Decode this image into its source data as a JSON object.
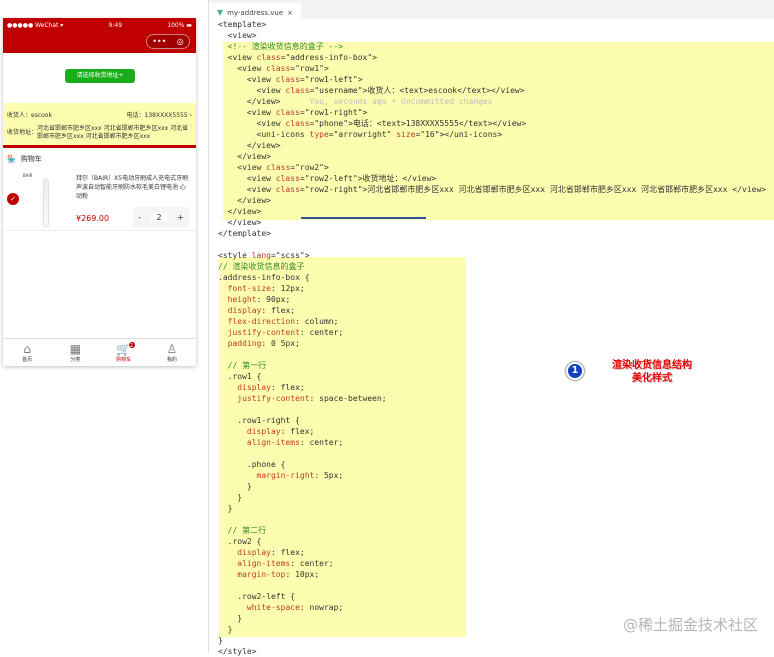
{
  "phone": {
    "status": {
      "carrier": "●●●●● WeChat ▾",
      "time": "9:49",
      "battery": "100% ▬"
    },
    "capsule": {
      "more": "•••",
      "close": "◎"
    },
    "choose_address_button": "请选择收货地址+",
    "address": {
      "consignee_label": "收货人：escook",
      "phone_label": "电话：138XXXX5555",
      "arrow": "›",
      "address_label": "收货地址：",
      "address_value": "河北省邯郸市肥乡区xxx 河北省邯郸市肥乡区xxx 河北省邯郸市肥乡区xxx 河北省邯郸市肥乡区xxx"
    },
    "cart_header": "购物车",
    "product": {
      "brand": "BAIR",
      "title": "拜尔（BAIR）X5电动牙刷成人充电式牙刷声波自动智能牙刷防水软毛美白锂电池 心动粉",
      "price": "¥269.00",
      "minus": "-",
      "qty": "2",
      "plus": "+"
    },
    "tabs": [
      {
        "label": "首页",
        "icon": "⌂"
      },
      {
        "label": "分类",
        "icon": "▦"
      },
      {
        "label": "购物车",
        "icon": "🛒",
        "badge": "2"
      },
      {
        "label": "我的",
        "icon": "♙"
      }
    ]
  },
  "editor": {
    "file_tab": "my-address.vue",
    "close": "×",
    "lines": [
      "<template>",
      "  <view>",
      "  <!-- 渲染收货信息的盒子 -->",
      "  <view class=\"address-info-box\">",
      "    <view class=\"row1\">",
      "      <view class=\"row1-left\">",
      "        <view class=\"username\">收货人：<text>escook</text></view>",
      "      </view>      You, seconds ago • Uncommitted changes",
      "      <view class=\"row1-right\">",
      "        <view class=\"phone\">电话：<text>138XXXX5555</text></view>",
      "        <uni-icons type=\"arrowright\" size=\"16\"></uni-icons>",
      "      </view>",
      "    </view>",
      "    <view class=\"row2\">",
      "      <view class=\"row2-left\">收货地址：</view>",
      "      <view class=\"row2-right\">河北省邯郸市肥乡区xxx 河北省邯郸市肥乡区xxx 河北省邯郸市肥乡区xxx 河北省邯郸市肥乡区xxx </view>",
      "    </view>",
      "  </view>",
      "  </view>",
      "</template>",
      "",
      "<style lang=\"scss\">",
      "// 渲染收货信息的盒子",
      ".address-info-box {",
      "  font-size: 12px;",
      "  height: 90px;",
      "  display: flex;",
      "  flex-direction: column;",
      "  justify-content: center;",
      "  padding: 0 5px;",
      "",
      "  // 第一行",
      "  .row1 {",
      "    display: flex;",
      "    justify-content: space-between;",
      "",
      "    .row1-right {",
      "      display: flex;",
      "      align-items: center;",
      "",
      "      .phone {",
      "        margin-right: 5px;",
      "      }",
      "    }",
      "  }",
      "",
      "  // 第二行",
      "  .row2 {",
      "    display: flex;",
      "    align-items: center;",
      "    margin-top: 10px;",
      "",
      "    .row2-left {",
      "      white-space: nowrap;",
      "    }",
      "  }",
      "}",
      "</style>"
    ]
  },
  "annotation": {
    "number": "1",
    "text_line1": "渲染收货信息结构",
    "text_line2": "美化样式"
  },
  "watermark": "@稀土掘金技术社区"
}
